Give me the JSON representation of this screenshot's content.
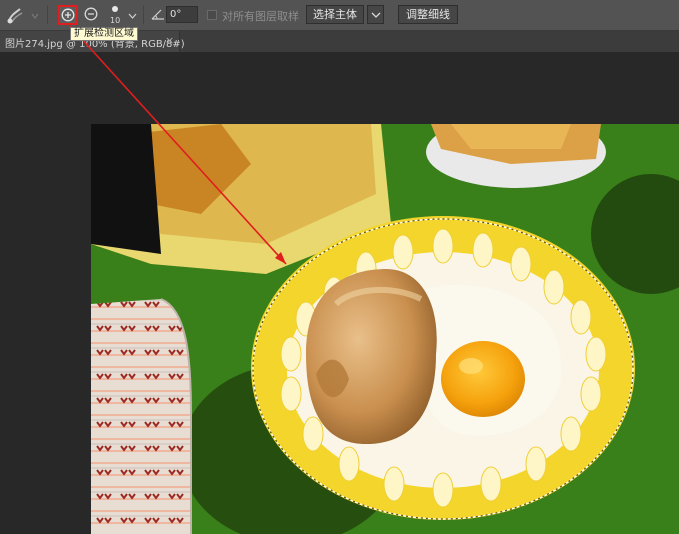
{
  "options_bar": {
    "tool": {
      "icon": "quick-selection-brush-icon"
    },
    "add_to_selection": {
      "icon": "circle-plus-icon",
      "tooltip": "扩展检测区域"
    },
    "subtract_from_selection": {
      "icon": "circle-minus-icon"
    },
    "brush_size": "10",
    "angle_icon": "angle-icon",
    "angle_value": "0°",
    "sample_all_layers": {
      "label": "对所有图层取样",
      "checked": false
    },
    "select_subject_label": "选择主体",
    "refine_edge_label": "调整细线"
  },
  "document_tab": {
    "title": "图片274.jpg @ 100% (背景, RGB/8#)",
    "close_glyph": "×"
  },
  "colors": {
    "highlight_red": "#e01e1e",
    "tablecloth_green": "#3f8a1e",
    "plate_yellow": "#f2d028",
    "toolbar_bg": "#535353"
  }
}
